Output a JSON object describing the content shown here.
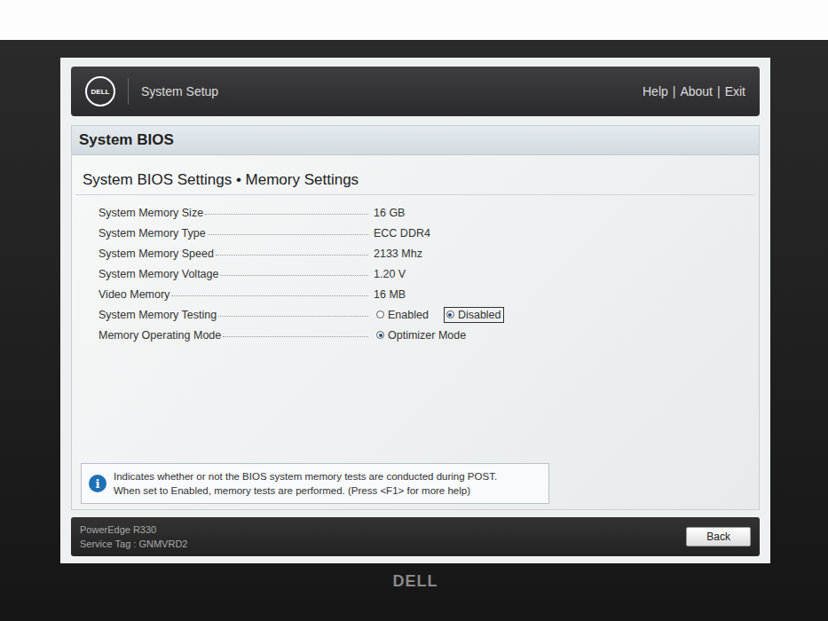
{
  "header": {
    "brand": "DELL",
    "title": "System Setup",
    "links": [
      "Help",
      "About",
      "Exit"
    ],
    "separator": "|"
  },
  "page": {
    "title": "System BIOS",
    "subtitle": "System BIOS Settings • Memory Settings"
  },
  "settings": [
    {
      "label": "System Memory Size",
      "kind": "text",
      "value": "16 GB"
    },
    {
      "label": "System Memory Type",
      "kind": "text",
      "value": "ECC DDR4"
    },
    {
      "label": "System Memory Speed",
      "kind": "text",
      "value": "2133 Mhz"
    },
    {
      "label": "System Memory Voltage",
      "kind": "text",
      "value": "1.20 V"
    },
    {
      "label": "Video Memory",
      "kind": "text",
      "value": "16 MB"
    },
    {
      "label": "System Memory Testing",
      "kind": "radio",
      "options": [
        {
          "label": "Enabled",
          "selected": false,
          "focused": false
        },
        {
          "label": "Disabled",
          "selected": true,
          "focused": true
        }
      ]
    },
    {
      "label": "Memory Operating Mode",
      "kind": "radio",
      "options": [
        {
          "label": "Optimizer Mode",
          "selected": true,
          "focused": false
        }
      ]
    }
  ],
  "info": {
    "icon": "i",
    "lines": [
      "Indicates whether or not the BIOS system memory tests are conducted during POST.",
      "When set to Enabled, memory tests are performed. (Press <F1> for more help)"
    ]
  },
  "footer": {
    "model": "PowerEdge R330",
    "service_tag": "Service Tag : GNMVRD2",
    "button": "Back"
  },
  "monitor": {
    "brand": "DELL"
  }
}
